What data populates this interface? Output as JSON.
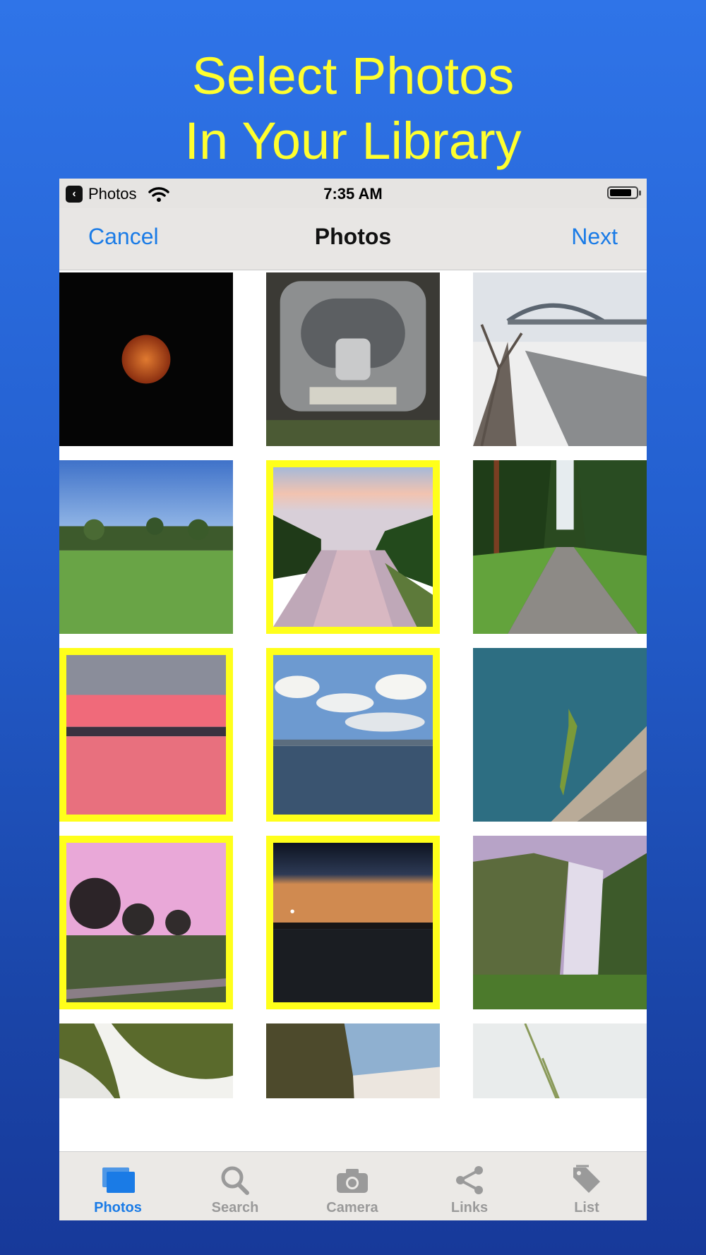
{
  "promo": {
    "line1": "Select Photos",
    "line2": "In Your Library"
  },
  "status_bar": {
    "back_app": "Photos",
    "time": "7:35 AM",
    "icons": [
      "chevron-left-icon",
      "wifi-icon",
      "battery-icon"
    ]
  },
  "nav": {
    "cancel_label": "Cancel",
    "title": "Photos",
    "next_label": "Next"
  },
  "photos": [
    {
      "subject": "lunar eclipse moon",
      "selected": false
    },
    {
      "subject": "engine close-up",
      "selected": false
    },
    {
      "subject": "bridge over snowy river",
      "selected": false
    },
    {
      "subject": "golf course lawn",
      "selected": false
    },
    {
      "subject": "canal at sunset",
      "selected": true
    },
    {
      "subject": "forest path",
      "selected": false
    },
    {
      "subject": "pink sunset over lake",
      "selected": true
    },
    {
      "subject": "lake with clouds",
      "selected": true
    },
    {
      "subject": "praying mantis",
      "selected": false
    },
    {
      "subject": "pink sky over trees",
      "selected": true
    },
    {
      "subject": "dusk over lake",
      "selected": true
    },
    {
      "subject": "waterfall in valley",
      "selected": false
    },
    {
      "subject": "waterfall rapids",
      "selected": false
    },
    {
      "subject": "waterfall gorge",
      "selected": false
    },
    {
      "subject": "beach grass with flower",
      "selected": false
    }
  ],
  "tabs": [
    {
      "label": "Photos",
      "icon": "photos-icon",
      "active": true
    },
    {
      "label": "Search",
      "icon": "search-icon",
      "active": false
    },
    {
      "label": "Camera",
      "icon": "camera-icon",
      "active": false
    },
    {
      "label": "Links",
      "icon": "share-icon",
      "active": false
    },
    {
      "label": "List",
      "icon": "tag-icon",
      "active": false
    }
  ],
  "colors": {
    "background": "#2460d0",
    "promo_text": "#ffff2e",
    "accent": "#1a7be6",
    "selection_border": "#ffff1a"
  }
}
